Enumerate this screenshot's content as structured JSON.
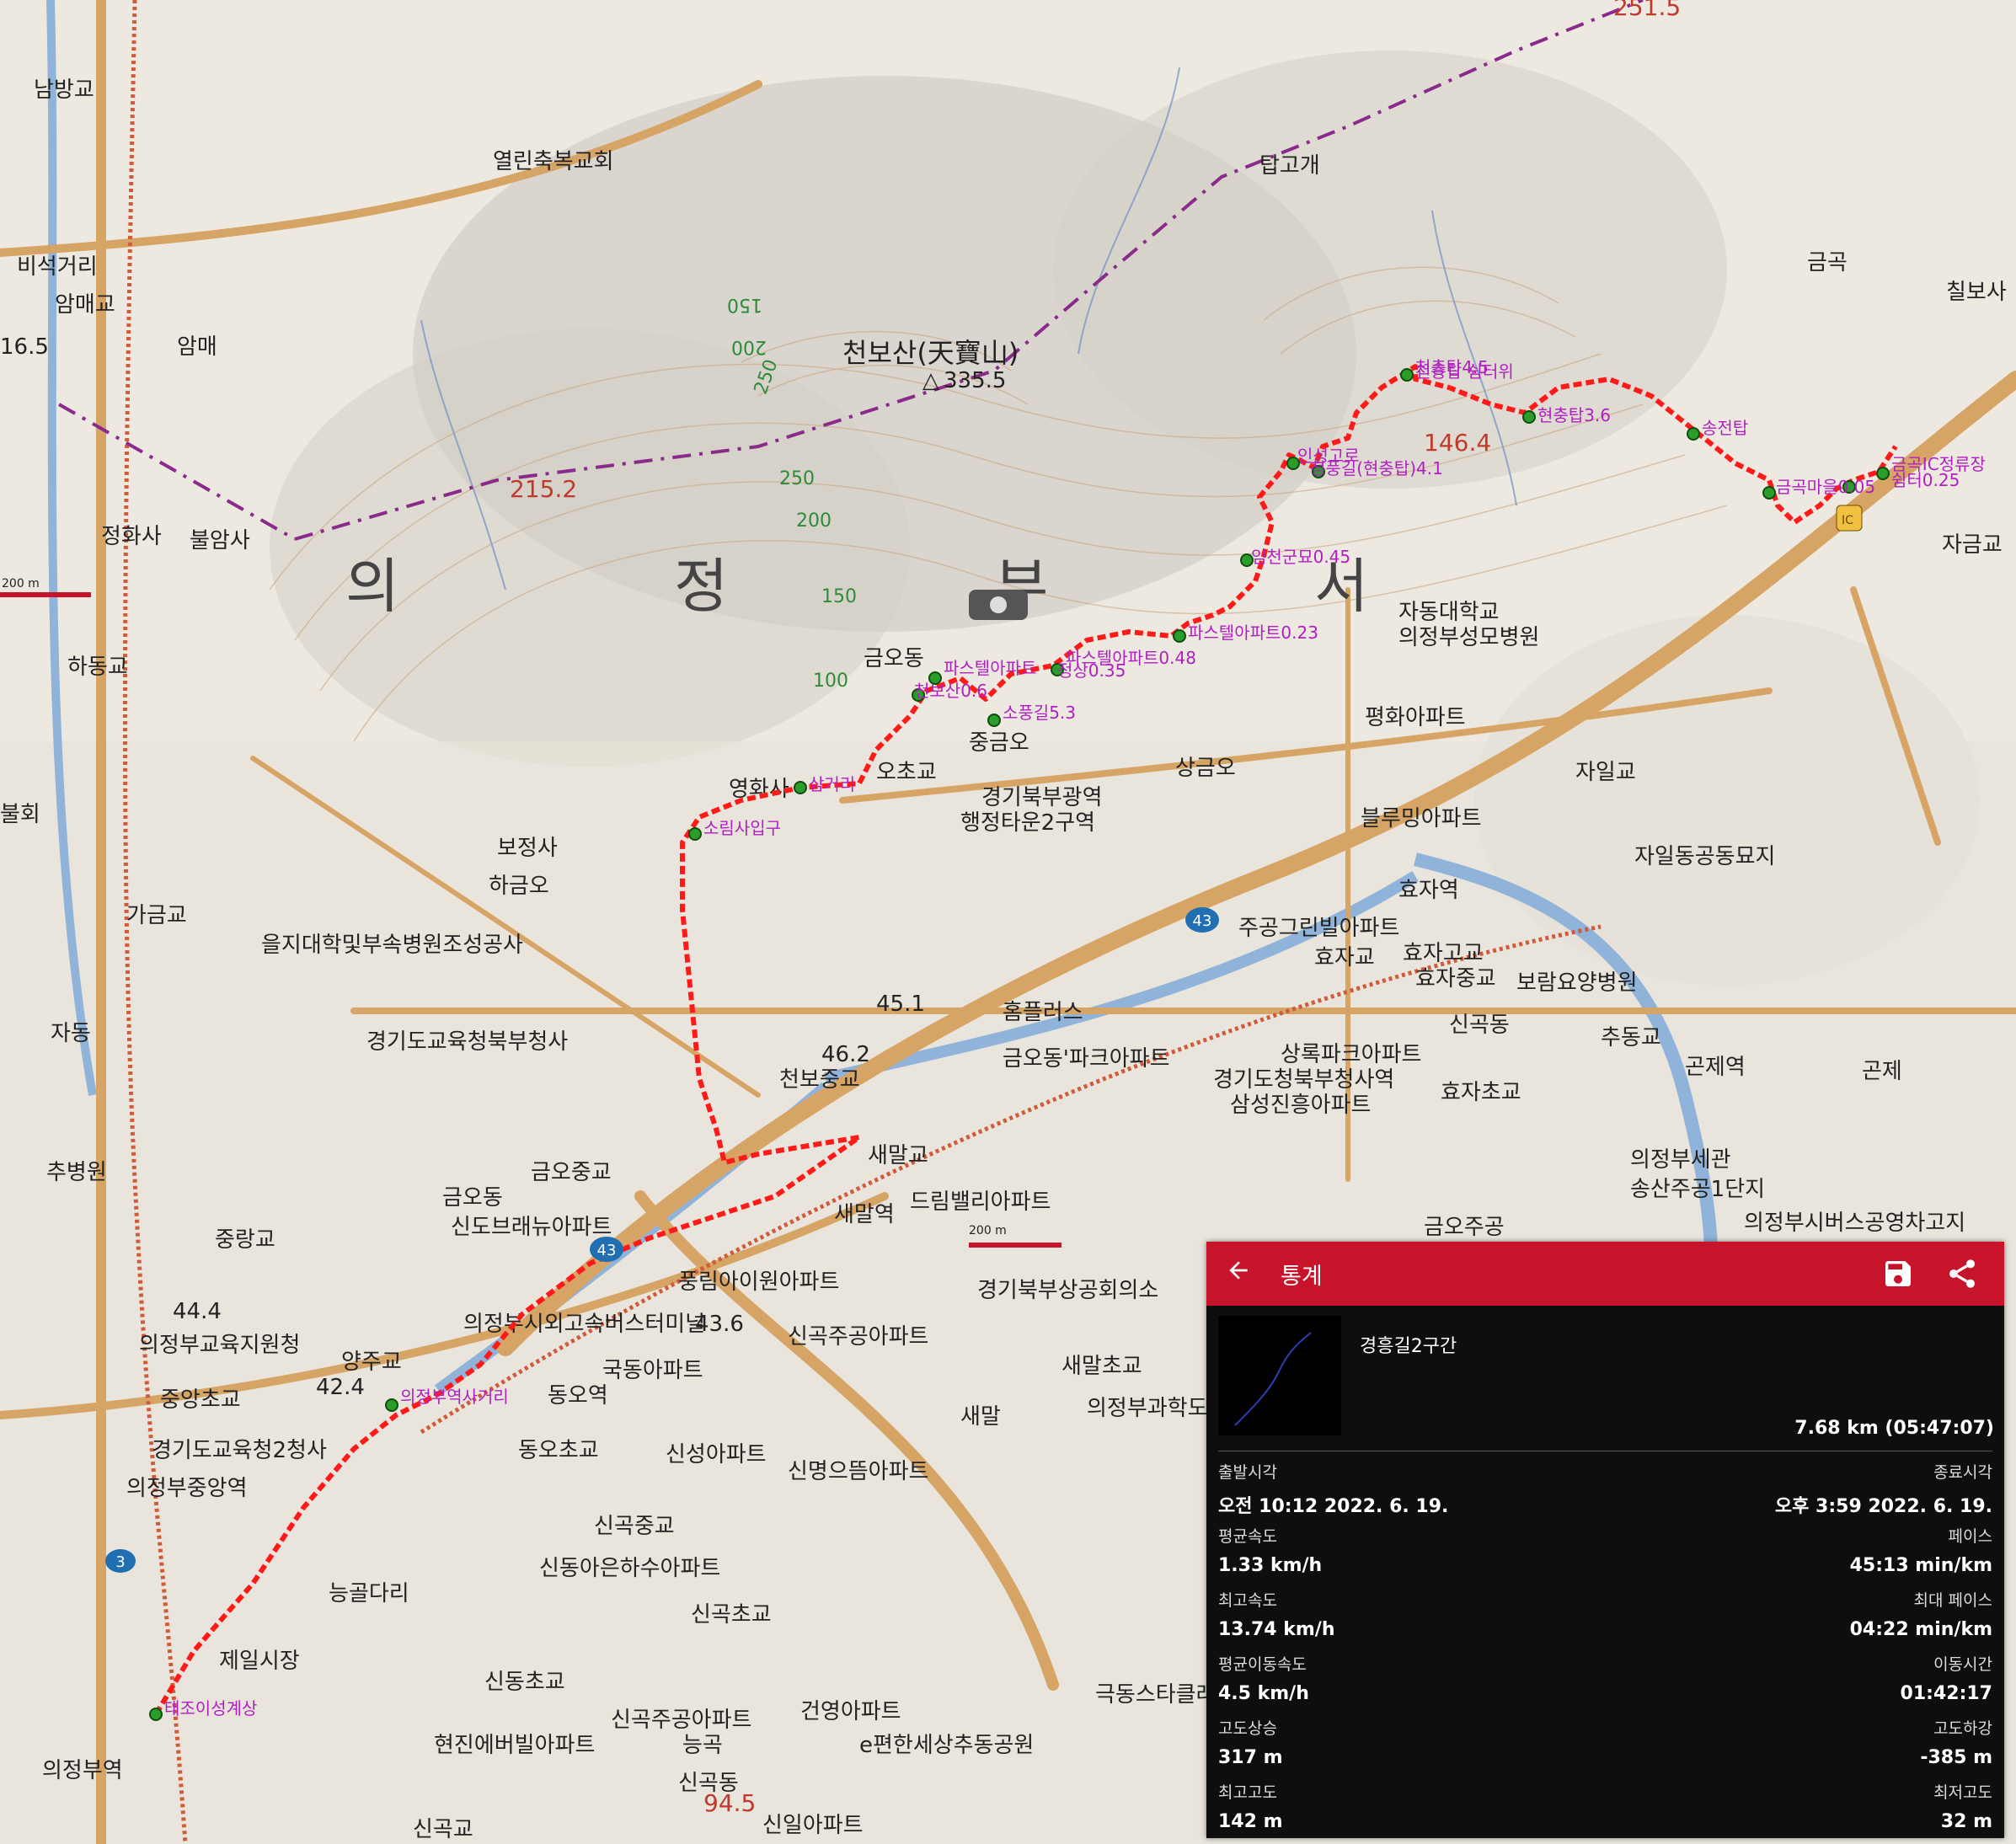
{
  "map": {
    "place_labels": [
      "남방교",
      "열린축복교회",
      "비석거리",
      "암매교",
      "암매",
      "16.5",
      "정화사",
      "불암사",
      "탑고개",
      "천보산(天寶山)",
      "335.5",
      "215.2",
      "251.5",
      "금곡",
      "칠보사",
      "하동교",
      "금오동",
      "중금오",
      "상금오",
      "자일교",
      "자일동공동묘지",
      "영화사",
      "오초교",
      "경기북부광역",
      "행정타운2구역",
      "보정사",
      "하금오",
      "불회",
      "가금교",
      "을지대학및부속병원조성공사",
      "자동",
      "경기도교육청북부청사",
      "천보중교",
      "46.2",
      "45.1",
      "홈플러스",
      "금오동'파크아파트",
      "신곡동",
      "추동교",
      "곤제역",
      "곤제",
      "효자역",
      "효자교",
      "주공그린빌아파트",
      "효자고교",
      "효자중교",
      "보람요양병원",
      "상록파크아파트",
      "경기도청북부청사역",
      "삼성진흥아파트",
      "효자초교",
      "의정부세관",
      "송산주공1단지",
      "의정부시버스공영차고지",
      "금오주공",
      "새말교",
      "새말역",
      "드림밸리아파트",
      "풍림아이원아파트",
      "신곡주공아파트",
      "새말초교",
      "새말",
      "의정부과학도",
      "경기북부상공회의소",
      "금오중교",
      "금오동",
      "신도브래뉴아파트",
      "중랑교",
      "추병원",
      "43.6",
      "44.4",
      "의정부교육지원청",
      "중앙초교",
      "경기도교육청2청사",
      "의정부중앙역",
      "양주교",
      "42.4",
      "의정부시외고속버스터미널",
      "동오역",
      "동오초교",
      "국동아파트",
      "신성아파트",
      "신명으뜸아파트",
      "신곡중교",
      "신동아은하수아파트",
      "신곡초교",
      "신동초교",
      "신곡주공아파트",
      "건영아파트",
      "e편한세상추동공원",
      "극동스타클래",
      "현진에버빌아파트",
      "신곡동",
      "능곡",
      "94.5",
      "신일아파트",
      "신곡교",
      "의정부역",
      "제일시장",
      "능골다리",
      "자동대학교",
      "의정부성모병원",
      "평화아파트",
      "블루밍아파트",
      "자금교",
      "46.2"
    ],
    "region_labels": [
      "의",
      "정",
      "부",
      "서"
    ],
    "peak": {
      "name": "천보산(天寶山)",
      "elev": "335.5"
    },
    "spot_heights": [
      "215.2",
      "146.4",
      "251.5",
      "94.5"
    ],
    "contours": [
      "150",
      "200",
      "250",
      "250",
      "200",
      "150",
      "100"
    ],
    "route_labels": [
      "천층탑4.5",
      "천층탑 쉼터위",
      "현충탑3.6",
      "송전탑",
      "금곡마을0.05",
      "쉼터0.25",
      "금곡IC정류장",
      "임도",
      "인성고로",
      "청풍길(현충탑)4.1",
      "임천군묘0.45",
      "파스텔아파트0.23",
      "파스텔아파트0.48",
      "파스텔아파트",
      "천보산0.6",
      "정상0.35",
      "소풍길5.3",
      "삼거리",
      "소림사입구",
      "의정부역사거리",
      "태조이성계상"
    ],
    "route_markers": [
      "43",
      "43",
      "3"
    ],
    "scale": "200 m"
  },
  "panel": {
    "header_title": "통계",
    "back_icon": "arrow-left-icon",
    "save_icon": "save-icon",
    "share_icon": "share-icon",
    "track_name": "경흥길2구간",
    "track_summary": "7.68 km (05:47:07)",
    "stats": [
      {
        "left_label": "출발시각",
        "left_value": "오전 10:12 2022. 6. 19.",
        "right_label": "종료시각",
        "right_value": "오후 3:59 2022. 6. 19."
      },
      {
        "left_label": "평균속도",
        "left_value": "1.33 km/h",
        "right_label": "페이스",
        "right_value": "45:13 min/km"
      },
      {
        "left_label": "최고속도",
        "left_value": "13.74 km/h",
        "right_label": "최대 페이스",
        "right_value": "04:22 min/km"
      },
      {
        "left_label": "평균이동속도",
        "left_value": "4.5 km/h",
        "right_label": "이동시간",
        "right_value": "01:42:17"
      },
      {
        "left_label": "고도상승",
        "left_value": "317 m",
        "right_label": "고도하강",
        "right_value": "-385 m"
      },
      {
        "left_label": "최고고도",
        "left_value": "142 m",
        "right_label": "최저고도",
        "right_value": "32 m"
      }
    ]
  },
  "colors": {
    "header": "#c8142a",
    "route": "#ff0000",
    "waypoint_text": "#b020c0",
    "road": "#d4a468"
  }
}
